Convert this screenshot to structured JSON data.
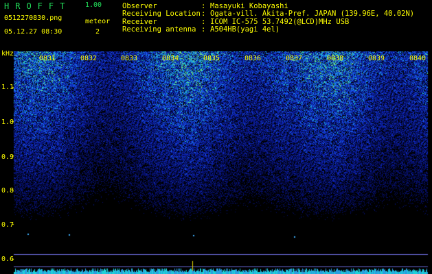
{
  "header": {
    "app_title": "HROFFT",
    "version": "1.00",
    "file_name": "0512270830.png",
    "meteor_label": "meteor",
    "timestamp": "05.12.27 08:30",
    "meteor_count": "2"
  },
  "info": [
    {
      "key": "Observer",
      "value": "Masayuki Kobayashi"
    },
    {
      "key": "Receiving Location",
      "value": "Ogata-vill. Akita-Pref. JAPAN (139.96E, 40.02N)"
    },
    {
      "key": "Receiver",
      "value": "ICOM IC-575 53.7492(@LCD)MHz USB"
    },
    {
      "key": "Receiving antenna",
      "value": "A504HB(yagi 4el)"
    }
  ],
  "y_axis": {
    "unit": "kHz",
    "ticks": [
      "1.1",
      "1.0",
      "0.9",
      "0.8",
      "0.7",
      "0.6"
    ]
  },
  "time_ticks": [
    "0831",
    "0832",
    "0833",
    "0834",
    "0835",
    "0836",
    "0837",
    "0838",
    "0839",
    "0840"
  ],
  "colors": {
    "background": "#000000",
    "text": "#ffff00",
    "title": "#22e05a",
    "noise_low": "#0a1fa0",
    "noise_mid": "#1f5cf0",
    "noise_high": "#1fd2c8",
    "reference_line": "#6a6ad8"
  }
}
